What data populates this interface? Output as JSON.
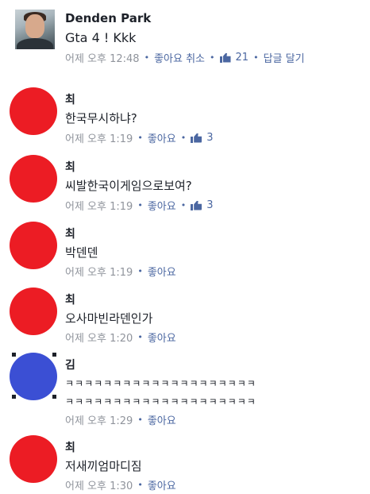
{
  "post": {
    "author": "Denden Park",
    "text": "Gta 4 ! Kkk",
    "time": "어제 오후 12:48",
    "like_label": "좋아요 취소",
    "likes": "21",
    "reply_label": "답글 달기"
  },
  "comments": [
    {
      "name": "최",
      "text": "한국무시하냐?",
      "time": "어제 오후 1:19",
      "like_label": "좋아요",
      "likes": "3",
      "avatar_color": "#ec1c24"
    },
    {
      "name": "최",
      "text": "씨발한국이게임으로보여?",
      "time": "어제 오후 1:19",
      "like_label": "좋아요",
      "likes": "3",
      "avatar_color": "#ec1c24"
    },
    {
      "name": "최",
      "text": "박덴덴",
      "time": "어제 오후 1:19",
      "like_label": "좋아요",
      "avatar_color": "#ec1c24"
    },
    {
      "name": "최",
      "text": "오사마빈라덴인가",
      "time": "어제 오후 1:20",
      "like_label": "좋아요",
      "avatar_color": "#ec1c24"
    },
    {
      "name": "김",
      "text_line1": "ㅋㅋㅋㅋㅋㅋㅋㅋㅋㅋㅋㅋㅋㅋㅋㅋㅋㅋㅋㅋ",
      "text_line2": "ㅋㅋㅋㅋㅋㅋㅋㅋㅋㅋㅋㅋㅋㅋㅋㅋㅋㅋㅋㅋ",
      "time": "어제 오후 1:29",
      "like_label": "좋아요",
      "avatar_color": "#3b4fd4"
    },
    {
      "name": "최",
      "text": "저새끼엄마디짐",
      "time": "어제 오후 1:30",
      "like_label": "좋아요",
      "avatar_color": "#ec1c24"
    }
  ]
}
